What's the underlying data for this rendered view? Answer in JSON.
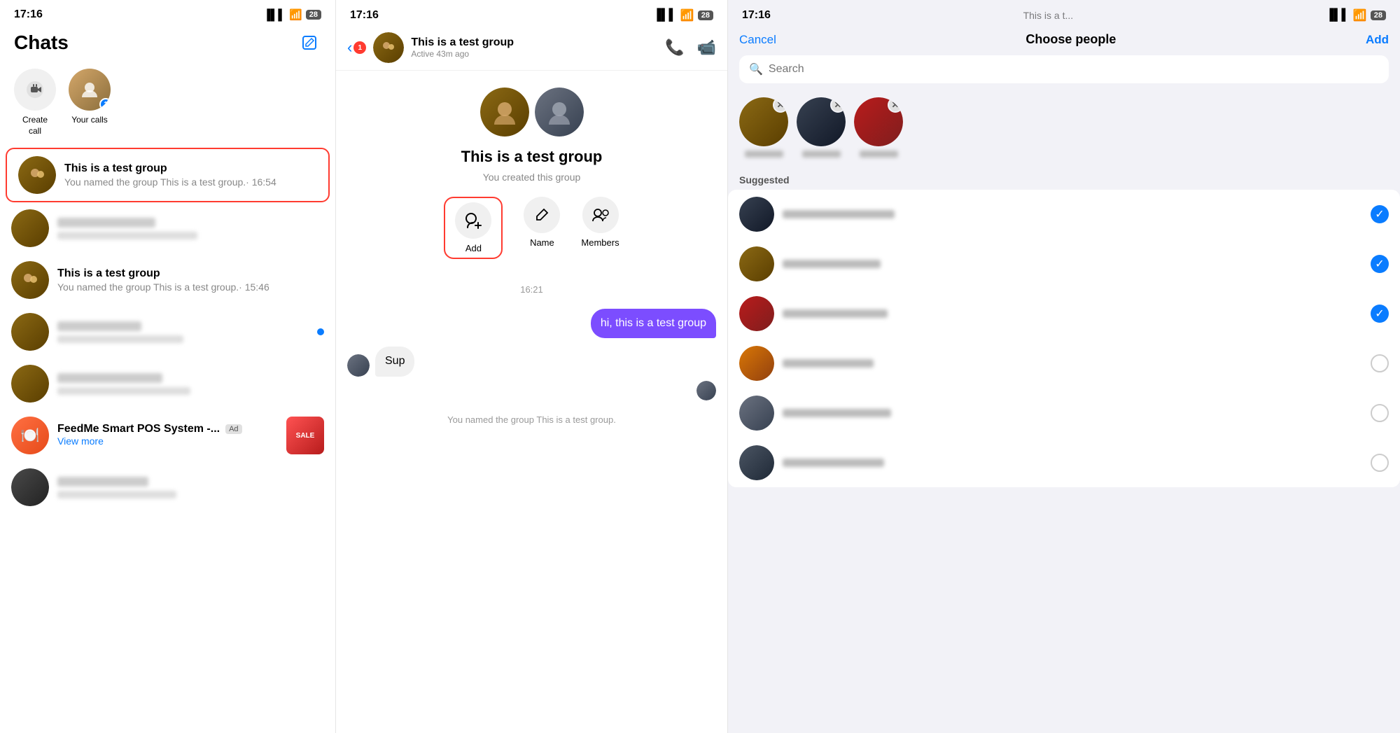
{
  "panel1": {
    "statusBar": {
      "time": "17:16",
      "battery": "28"
    },
    "header": {
      "title": "Chats"
    },
    "quickActions": [
      {
        "label": "Create\ncall",
        "icon": "📹"
      },
      {
        "label": "Your calls",
        "icon": "👤"
      }
    ],
    "chats": [
      {
        "id": "chat1",
        "name": "This is a test group",
        "preview": "You named the group This is a test group.· 16:54",
        "selected": true,
        "avatarType": "group"
      },
      {
        "id": "chat2",
        "name": "",
        "preview": "",
        "selected": false,
        "avatarType": "person1"
      },
      {
        "id": "chat3",
        "name": "This is a test group",
        "preview": "You named the group This is a test group.· 15:46",
        "selected": false,
        "avatarType": "group2"
      },
      {
        "id": "chat4",
        "name": "",
        "preview": "",
        "selected": false,
        "avatarType": "person2",
        "unread": true
      },
      {
        "id": "chat5",
        "name": "",
        "preview": "",
        "selected": false,
        "avatarType": "person3"
      },
      {
        "id": "chat6",
        "name": "FeedMe Smart POS System -...",
        "preview": "View more",
        "selected": false,
        "avatarType": "feedme",
        "isAd": true
      },
      {
        "id": "chat7",
        "name": "",
        "preview": "",
        "selected": false,
        "avatarType": "person4"
      }
    ]
  },
  "panel2": {
    "statusBar": {
      "time": "17:16",
      "battery": "28"
    },
    "header": {
      "name": "This is a test group",
      "status": "Active 43m ago"
    },
    "backBadge": "1",
    "groupInfo": {
      "name": "This is a test group",
      "subtitle": "You created this group"
    },
    "actions": [
      {
        "label": "Add",
        "icon": "👤+",
        "selected": true
      },
      {
        "label": "Name",
        "icon": "✏️",
        "selected": false
      },
      {
        "label": "Members",
        "icon": "👥",
        "selected": false
      }
    ],
    "messages": [
      {
        "type": "timestamp",
        "text": "16:21"
      },
      {
        "type": "outgoing",
        "text": "hi, this is a test group"
      },
      {
        "type": "incoming",
        "text": "Sup",
        "hasAvatar": true
      },
      {
        "type": "system",
        "text": "You named the group This is a test group."
      }
    ]
  },
  "panel3": {
    "statusBar": {
      "time": "17:16",
      "battery": "28"
    },
    "partialTitle": "This is a t...",
    "header": {
      "cancelLabel": "Cancel",
      "title": "Choose people",
      "addLabel": "Add"
    },
    "searchPlaceholder": "Search",
    "selectedPeople": [
      {
        "id": "p1",
        "avatarType": "s1"
      },
      {
        "id": "p2",
        "avatarType": "s2"
      },
      {
        "id": "p3",
        "avatarType": "s3"
      }
    ],
    "suggestedLabel": "Suggested",
    "suggestedPeople": [
      {
        "id": "sp1",
        "avatarType": "su1",
        "checked": true
      },
      {
        "id": "sp2",
        "avatarType": "su2",
        "checked": true
      },
      {
        "id": "sp3",
        "avatarType": "su3",
        "checked": true
      },
      {
        "id": "sp4",
        "avatarType": "su4",
        "checked": false
      },
      {
        "id": "sp5",
        "avatarType": "su5",
        "checked": false
      },
      {
        "id": "sp6",
        "avatarType": "su6",
        "checked": false
      }
    ]
  }
}
